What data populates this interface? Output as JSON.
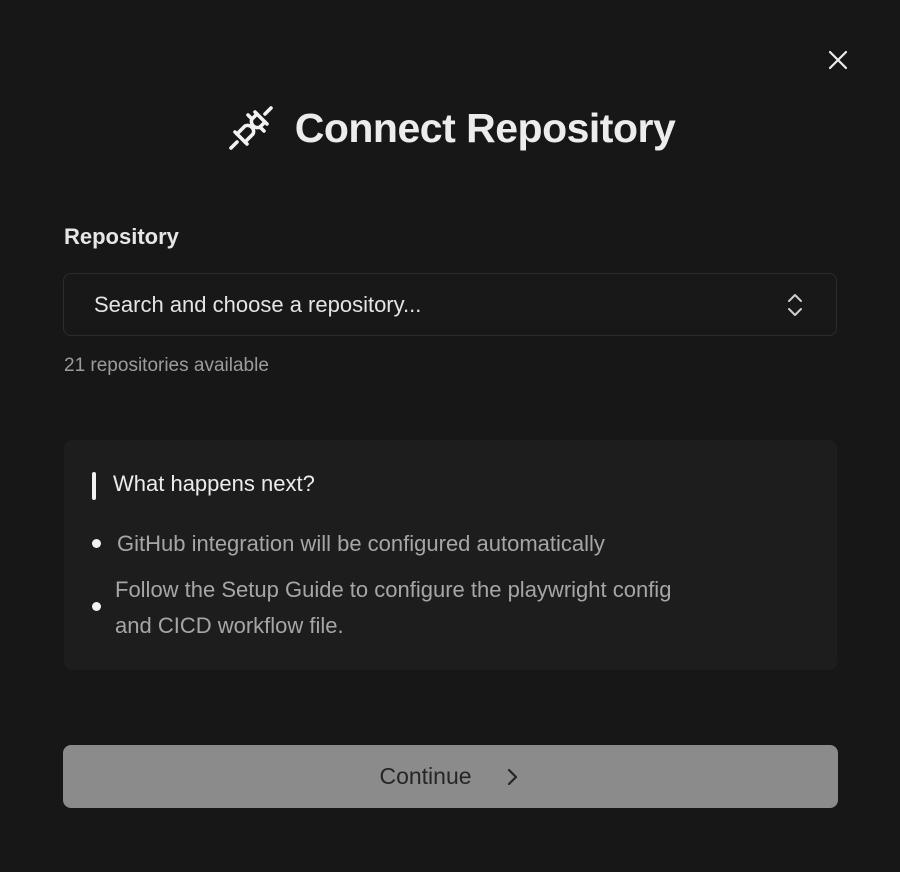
{
  "dialog": {
    "title": "Connect Repository",
    "close_icon": "close-icon",
    "header_icon": "plug-disconnected-icon"
  },
  "repository_field": {
    "label": "Repository",
    "placeholder": "Search and choose a repository...",
    "selector_icon": "chevron-up-down-icon",
    "helper_text": "21 repositories available"
  },
  "next_steps": {
    "title": "What happens next?",
    "items": [
      {
        "line1": "GitHub integration will be configured automatically"
      },
      {
        "line1": "Follow the Setup Guide to configure the playwright config",
        "line2": "and CICD workflow file."
      }
    ]
  },
  "actions": {
    "continue_label": "Continue",
    "continue_icon": "chevron-right-icon"
  },
  "colors": {
    "background": "#171717",
    "panel": "#1d1d1d",
    "button_disabled": "#8b8b8b"
  }
}
